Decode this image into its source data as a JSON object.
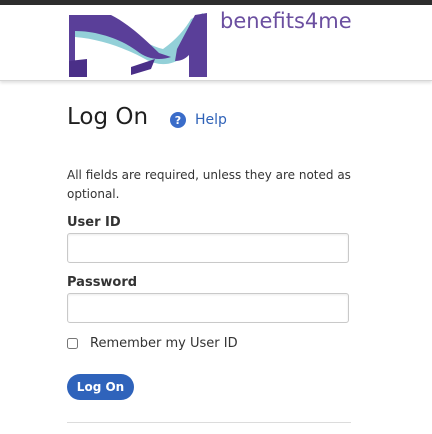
{
  "brand": {
    "name": "benefits4me"
  },
  "page": {
    "title": "Log On",
    "help_label": "Help"
  },
  "form": {
    "required_note": "All fields are required, unless they are noted as optional.",
    "user_id": {
      "label": "User ID",
      "value": "",
      "placeholder": ""
    },
    "password": {
      "label": "Password",
      "value": "",
      "placeholder": ""
    },
    "remember": {
      "label": "Remember my User ID",
      "checked": false
    },
    "submit_label": "Log On"
  },
  "colors": {
    "brand_purple": "#6b4fa0",
    "logo_teal": "#93d0d8",
    "accent_blue": "#2f63bb",
    "link_blue": "#2f62b8"
  },
  "icons": {
    "help": "question-circle-icon"
  }
}
